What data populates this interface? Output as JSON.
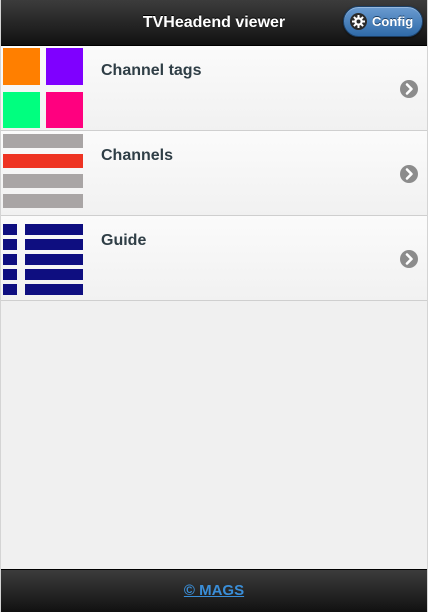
{
  "header": {
    "title": "TVHeadend viewer",
    "config_label": "Config",
    "config_icon": "gear-icon"
  },
  "items": [
    {
      "label": "Channel tags",
      "thumbnail": "channel-tags-thumbnail",
      "chevron_icon": "chevron-right-icon"
    },
    {
      "label": "Channels",
      "thumbnail": "channels-thumbnail",
      "chevron_icon": "chevron-right-icon"
    },
    {
      "label": "Guide",
      "thumbnail": "guide-thumbnail",
      "chevron_icon": "chevron-right-icon"
    }
  ],
  "footer": {
    "link_label": "© MAGS"
  },
  "colors": {
    "header_bg": "#1e1e1e",
    "config_button": "#3d7bbd",
    "tag_orange": "#ff7f00",
    "tag_violet": "#7f00ff",
    "tag_green": "#00ff7f",
    "tag_pink": "#ff007f",
    "channel_gray": "#a9a5a5",
    "channel_red": "#ee3322",
    "guide_navy": "#0e0e80",
    "footer_link": "#3a8ed8"
  }
}
